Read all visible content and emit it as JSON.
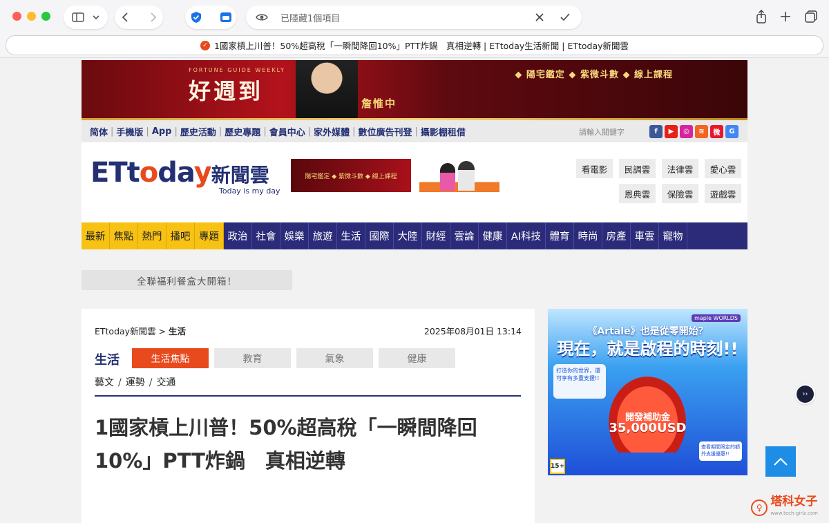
{
  "browser": {
    "address_text": "已隱藏1個項目",
    "tab_title": "1國家槓上川普！50%超高稅「一瞬間降回10%」PTT炸鍋　真相逆轉 | ETtoday生活新聞 | ETtoday新聞雲"
  },
  "banner": {
    "title": "好週到",
    "subtitle": "FORTUNE GUIDE WEEKLY",
    "master": "詹惟中",
    "tags": "◆ 陽宅鑑定 ◆ 紫微斗數 ◆ 線上課程"
  },
  "topnav": {
    "links": [
      "简体",
      "手機版",
      "App",
      "歷史活動",
      "歷史專題",
      "會員中心",
      "家外媒體",
      "數位廣告刊登",
      "攝影棚租借"
    ],
    "search_placeholder": "請輸入關鍵字"
  },
  "social": [
    {
      "icon": "facebook-icon",
      "color": "#3b5998",
      "glyph": "f"
    },
    {
      "icon": "youtube-icon",
      "color": "#e62117",
      "glyph": "▶"
    },
    {
      "icon": "instagram-icon",
      "color": "#d6249f",
      "glyph": "◎"
    },
    {
      "icon": "rss-icon",
      "color": "#f26522",
      "glyph": "≋"
    },
    {
      "icon": "weibo-icon",
      "color": "#e6162d",
      "glyph": "微"
    },
    {
      "icon": "google-news-icon",
      "color": "#4285f4",
      "glyph": "G"
    }
  ],
  "logo": {
    "text_prefix": "ETt",
    "text_o": "o",
    "text_mid": "da",
    "text_y": "y",
    "text_cn": "新聞雲",
    "tagline": "Today is my day"
  },
  "header_ad1": "陽宅鑑定 ◆ 紫微斗數 ◆ 線上課程",
  "clouds": [
    "看電影",
    "民調雲",
    "法律雲",
    "愛心雲",
    "恩典雲",
    "保險雲",
    "遊戲雲"
  ],
  "mainnav": {
    "highlight": [
      "最新",
      "焦點",
      "熱門",
      "播吧",
      "專題"
    ],
    "items": [
      "政治",
      "社會",
      "娛樂",
      "旅遊",
      "生活",
      "國際",
      "大陸",
      "財經",
      "雲論",
      "健康",
      "AI科技",
      "體育",
      "時尚",
      "房產",
      "車雲",
      "寵物"
    ]
  },
  "promo": "全聯福利餐盒大開箱！",
  "article": {
    "breadcrumb_home": "ETtoday新聞雲 >",
    "breadcrumb_cat": "生活",
    "date": "2025年08月01日 13:14",
    "category": "生活",
    "tabs": [
      "生活焦點",
      "教育",
      "氣象",
      "健康"
    ],
    "sublinks": [
      "藝文",
      "運勢",
      "交通"
    ],
    "headline": "1國家槓上川普！50%超高稅「一瞬間降回10%」PTT炸鍋　真相逆轉"
  },
  "side_ad": {
    "line1": "《Artale》也是從零開始？",
    "line2": "現在，就是啟程的時刻!!",
    "brand": "maple WORLDS",
    "card_left": "打造你的世界，還可享有多重支援!!",
    "fund_label": "開發補助金",
    "fund_amount": "35,000USD",
    "card_right": "查看期間限定的額外支援優惠!!",
    "rating": "15+"
  },
  "float_button": "››",
  "watermark": {
    "name": "塔科女子",
    "site": "www.tech-girlz.com"
  }
}
